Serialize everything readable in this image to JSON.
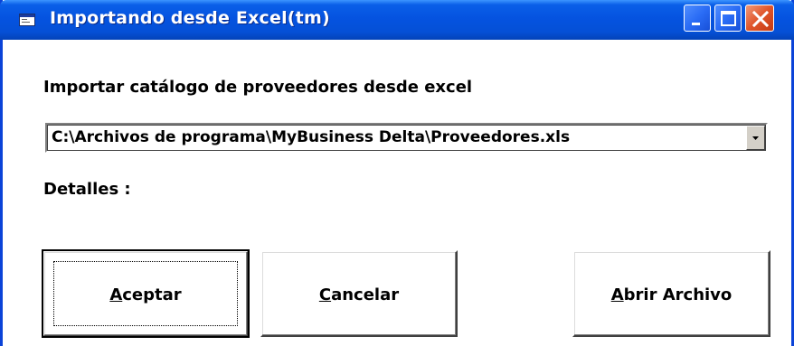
{
  "window": {
    "title": "Importando desde Excel(tm)",
    "title_bar_color": "#0553e0",
    "close_button_color": "#e0552a"
  },
  "icons": {
    "app": "app-window-icon",
    "minimize": "minimize-icon",
    "maximize": "maximize-icon",
    "close": "close-icon",
    "dropdown": "chevron-down-icon"
  },
  "form": {
    "heading": "Importar catálogo de proveedores desde excel",
    "file_path": "C:\\Archivos de programa\\MyBusiness Delta\\Proveedores.xls",
    "details_label": "Detalles :"
  },
  "buttons": {
    "accept": "Aceptar",
    "cancel": "Cancelar",
    "open_file": "Abrir Archivo"
  }
}
